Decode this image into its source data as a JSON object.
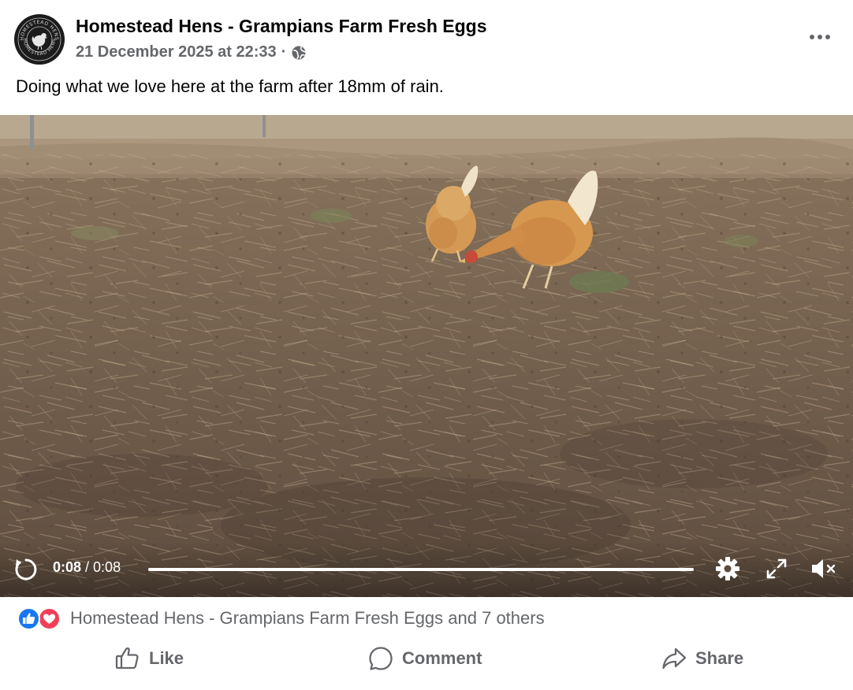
{
  "post": {
    "page_name": "Homestead Hens - Grampians Farm Fresh Eggs",
    "timestamp": "21 December 2025 at 22:33",
    "separator": "·",
    "privacy_icon": "globe-icon",
    "more_icon": "more-horizontal-icon",
    "caption": "Doing what we love here at the farm after 18mm of rain.",
    "avatar": {
      "icon": "homestead-hens-logo",
      "text_top": "HOMESTEAD HENS",
      "text_bottom": "HOMESTEAD HENS"
    }
  },
  "video": {
    "current_time": "0:08",
    "time_separator": " / ",
    "duration": "0:08",
    "progress": 1.0,
    "replay_icon": "replay-icon",
    "settings_icon": "gear-icon",
    "fullscreen_icon": "fullscreen-icon",
    "mute_icon": "volume-muted-icon"
  },
  "reactions": {
    "types": [
      "like",
      "love"
    ],
    "summary": "Homestead Hens - Grampians Farm Fresh Eggs and 7 others",
    "colors": {
      "like": "#1877f2",
      "love": "#f33e58"
    }
  },
  "actions": [
    {
      "label": "Like",
      "icon": "thumbs-up-icon"
    },
    {
      "label": "Comment",
      "icon": "comment-bubble-icon"
    },
    {
      "label": "Share",
      "icon": "share-arrow-icon"
    }
  ],
  "colors": {
    "text_primary": "#050505",
    "text_secondary": "#65676b"
  }
}
